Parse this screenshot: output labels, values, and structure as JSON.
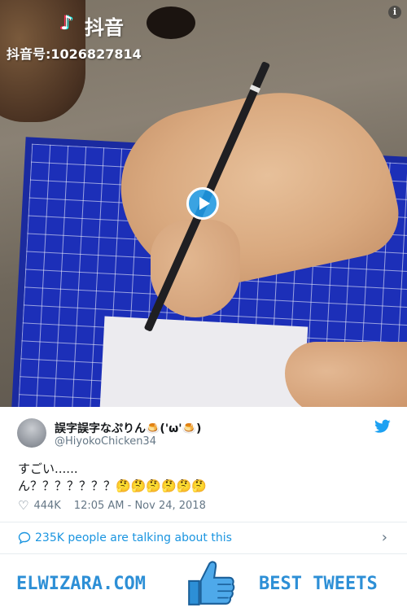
{
  "video": {
    "watermark_logo": "♪",
    "watermark_brand": "抖音",
    "watermark_id": "抖音号:1026827814",
    "info_icon": "i"
  },
  "tweet": {
    "display_name": "誤字誤字なぷりん🍮('ω'🍮)",
    "handle": "@HiyokoChicken34",
    "text": "すごい......\nん？？？？？？？🤔🤔🤔🤔🤔🤔",
    "likes": "444K",
    "timestamp": "12:05 AM - Nov 24, 2018",
    "talking": "235K people are talking about this"
  },
  "banner": {
    "left": "ELWIZARA.COM",
    "right": "BEST TWEETS"
  },
  "colors": {
    "twitter_blue": "#1da1f2",
    "link_blue": "#1b95e0",
    "banner_blue": "#2d8fd6",
    "muted": "#657786"
  },
  "icons": [
    "info-icon",
    "play-icon",
    "twitter-bird-icon",
    "heart-icon",
    "speech-bubble-icon",
    "chevron-right-icon",
    "thumbs-up-icon"
  ]
}
